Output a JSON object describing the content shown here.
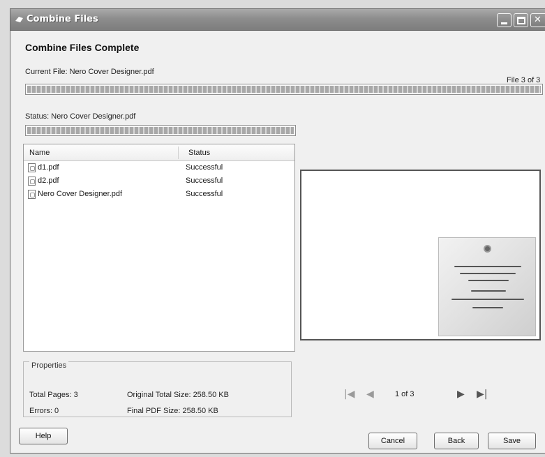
{
  "window": {
    "title": "Combine Files"
  },
  "heading": "Combine Files Complete",
  "current_file": {
    "label": "Current File: Nero Cover Designer.pdf",
    "counter": "File 3 of 3",
    "progress": 1.0
  },
  "status": {
    "label": "Status: Nero Cover Designer.pdf",
    "progress": 1.0
  },
  "file_list": {
    "columns": [
      "Name",
      "Status"
    ],
    "rows": [
      {
        "name": "d1.pdf",
        "status": "Successful"
      },
      {
        "name": "d2.pdf",
        "status": "Successful"
      },
      {
        "name": "Nero Cover Designer.pdf",
        "status": "Successful"
      }
    ]
  },
  "properties": {
    "title": "Properties",
    "total_pages": "Total Pages: 3",
    "errors": "Errors: 0",
    "original_size": "Original Total Size: 258.50 KB",
    "final_size": "Final PDF Size: 258.50 KB"
  },
  "preview_nav": {
    "page_indicator": "1 of 3"
  },
  "buttons": {
    "help": "Help",
    "cancel": "Cancel",
    "back": "Back",
    "save": "Save"
  },
  "icons": [
    "window-icon",
    "minimize-icon",
    "maximize-icon",
    "close-icon",
    "pdf-file-icon",
    "first-page-icon",
    "previous-page-icon",
    "next-page-icon",
    "last-page-icon"
  ]
}
